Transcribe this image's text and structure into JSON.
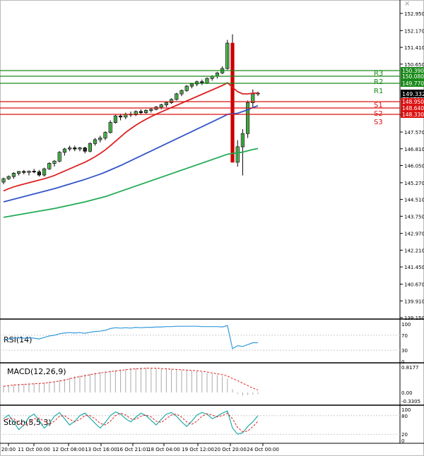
{
  "chart_data": {
    "type": "candlestick",
    "main": {
      "y_ticks": [
        "152.950",
        "152.170",
        "151.410",
        "150.650",
        "149.110",
        "148.350",
        "147.570",
        "146.810",
        "146.050",
        "145.270",
        "144.510",
        "143.750",
        "142.970",
        "142.210",
        "141.450",
        "140.670",
        "139.910",
        "139.150"
      ],
      "current_price": "149.332",
      "levels": [
        {
          "name": "R3",
          "value": "150.390",
          "kind": "resistance"
        },
        {
          "name": "R2",
          "value": "150.080",
          "kind": "resistance"
        },
        {
          "name": "R1",
          "value": "149.770",
          "kind": "resistance"
        },
        {
          "name": "S1",
          "value": "148.950",
          "kind": "support"
        },
        {
          "name": "S2",
          "value": "148.640",
          "kind": "support"
        },
        {
          "name": "S3",
          "value": "148.330",
          "kind": "support"
        }
      ],
      "candles": [
        [
          145.3,
          145.5,
          145.2,
          145.45
        ],
        [
          145.45,
          145.6,
          145.4,
          145.55
        ],
        [
          145.55,
          145.75,
          145.45,
          145.7
        ],
        [
          145.7,
          145.8,
          145.6,
          145.78
        ],
        [
          145.78,
          145.85,
          145.65,
          145.74
        ],
        [
          145.74,
          145.82,
          145.6,
          145.79
        ],
        [
          145.79,
          145.9,
          145.7,
          145.76
        ],
        [
          145.76,
          145.85,
          145.55,
          145.62
        ],
        [
          145.62,
          145.95,
          145.55,
          145.9
        ],
        [
          145.9,
          146.2,
          145.85,
          146.15
        ],
        [
          146.15,
          146.3,
          146.0,
          146.25
        ],
        [
          146.25,
          146.7,
          146.2,
          146.65
        ],
        [
          146.65,
          146.85,
          146.5,
          146.8
        ],
        [
          146.8,
          146.95,
          146.7,
          146.85
        ],
        [
          146.85,
          146.95,
          146.7,
          146.8
        ],
        [
          146.8,
          146.9,
          146.7,
          146.85
        ],
        [
          146.85,
          146.9,
          146.6,
          146.7
        ],
        [
          146.7,
          147.1,
          146.65,
          147.05
        ],
        [
          147.05,
          147.3,
          146.95,
          147.22
        ],
        [
          147.22,
          147.4,
          147.1,
          147.3
        ],
        [
          147.3,
          147.6,
          147.2,
          147.55
        ],
        [
          147.55,
          148.1,
          147.5,
          148.0
        ],
        [
          148.0,
          148.35,
          147.95,
          148.3
        ],
        [
          148.3,
          148.4,
          148.1,
          148.25
        ],
        [
          148.25,
          148.45,
          148.15,
          148.38
        ],
        [
          148.38,
          148.5,
          148.25,
          148.35
        ],
        [
          148.35,
          148.55,
          148.3,
          148.5
        ],
        [
          148.5,
          148.6,
          148.35,
          148.45
        ],
        [
          148.45,
          148.6,
          148.4,
          148.55
        ],
        [
          148.55,
          148.65,
          148.45,
          148.6
        ],
        [
          148.6,
          148.75,
          148.55,
          148.7
        ],
        [
          148.7,
          148.85,
          148.6,
          148.8
        ],
        [
          148.8,
          148.95,
          148.7,
          148.9
        ],
        [
          148.9,
          149.1,
          148.85,
          149.05
        ],
        [
          149.05,
          149.35,
          149.0,
          149.3
        ],
        [
          149.3,
          149.5,
          149.2,
          149.45
        ],
        [
          149.45,
          149.7,
          149.4,
          149.65
        ],
        [
          149.65,
          149.8,
          149.55,
          149.75
        ],
        [
          149.75,
          149.9,
          149.65,
          149.85
        ],
        [
          149.85,
          149.95,
          149.7,
          149.8
        ],
        [
          149.8,
          150.05,
          149.75,
          150.0
        ],
        [
          150.0,
          150.15,
          149.9,
          150.1
        ],
        [
          150.1,
          150.3,
          150.0,
          150.25
        ],
        [
          150.25,
          150.55,
          150.2,
          150.45
        ],
        [
          150.45,
          151.75,
          150.4,
          151.6
        ],
        [
          151.6,
          152.0,
          146.7,
          146.2
        ],
        [
          146.2,
          147.2,
          146.0,
          146.9
        ],
        [
          146.9,
          147.7,
          145.6,
          147.5
        ],
        [
          147.5,
          149.0,
          147.3,
          148.9
        ],
        [
          148.9,
          149.5,
          148.7,
          149.3
        ],
        [
          149.3,
          149.4,
          149.2,
          149.33
        ]
      ],
      "ma_fast": [
        144.9,
        145.0,
        145.08,
        145.15,
        145.21,
        145.27,
        145.33,
        145.39,
        145.45,
        145.52,
        145.6,
        145.7,
        145.8,
        145.9,
        146.0,
        146.1,
        146.2,
        146.32,
        146.45,
        146.6,
        146.76,
        146.95,
        147.15,
        147.35,
        147.55,
        147.72,
        147.88,
        148.02,
        148.15,
        148.27,
        148.38,
        148.48,
        148.58,
        148.68,
        148.78,
        148.88,
        148.98,
        149.08,
        149.18,
        149.28,
        149.38,
        149.48,
        149.58,
        149.68,
        149.8,
        149.6,
        149.4,
        149.3,
        149.3,
        149.33,
        149.34
      ],
      "ma_mid": [
        144.4,
        144.46,
        144.52,
        144.58,
        144.64,
        144.7,
        144.76,
        144.82,
        144.88,
        144.94,
        145.0,
        145.07,
        145.14,
        145.21,
        145.28,
        145.35,
        145.42,
        145.5,
        145.58,
        145.66,
        145.75,
        145.85,
        145.95,
        146.05,
        146.16,
        146.27,
        146.38,
        146.49,
        146.6,
        146.71,
        146.82,
        146.93,
        147.04,
        147.15,
        147.26,
        147.37,
        147.48,
        147.59,
        147.7,
        147.81,
        147.92,
        148.03,
        148.14,
        148.25,
        148.37,
        148.4,
        148.42,
        148.5,
        148.58,
        148.68,
        148.76
      ],
      "ma_slow": [
        143.7,
        143.74,
        143.78,
        143.82,
        143.86,
        143.9,
        143.94,
        143.98,
        144.02,
        144.06,
        144.1,
        144.15,
        144.2,
        144.25,
        144.3,
        144.35,
        144.4,
        144.46,
        144.52,
        144.58,
        144.64,
        144.72,
        144.8,
        144.88,
        144.96,
        145.04,
        145.12,
        145.2,
        145.28,
        145.36,
        145.44,
        145.52,
        145.6,
        145.68,
        145.76,
        145.84,
        145.92,
        146.0,
        146.08,
        146.16,
        146.24,
        146.32,
        146.4,
        146.48,
        146.56,
        146.6,
        146.62,
        146.66,
        146.72,
        146.78,
        146.82
      ]
    },
    "rsi": {
      "label": "RSI(14)",
      "y_ticks": [
        "100",
        "70",
        "30",
        "0"
      ],
      "values": [
        58,
        60,
        62,
        63,
        62,
        63,
        62,
        60,
        64,
        68,
        70,
        74,
        76,
        77,
        76,
        77,
        75,
        78,
        80,
        81,
        83,
        88,
        90,
        89,
        90,
        89,
        91,
        90,
        91,
        91,
        92,
        92,
        93,
        93,
        94,
        94,
        94,
        94,
        94,
        93,
        93,
        93,
        93,
        92,
        96,
        34,
        42,
        40,
        45,
        50,
        50
      ]
    },
    "macd": {
      "label": "MACD(12,26,9)",
      "y_ticks": [
        "0.8177",
        "0.00",
        "-0.3305"
      ],
      "histogram": [
        0.22,
        0.24,
        0.26,
        0.27,
        0.28,
        0.29,
        0.3,
        0.3,
        0.32,
        0.34,
        0.36,
        0.4,
        0.44,
        0.48,
        0.52,
        0.55,
        0.58,
        0.61,
        0.64,
        0.66,
        0.68,
        0.7,
        0.72,
        0.74,
        0.76,
        0.78,
        0.79,
        0.8,
        0.8,
        0.79,
        0.78,
        0.77,
        0.76,
        0.75,
        0.74,
        0.72,
        0.71,
        0.7,
        0.68,
        0.66,
        0.63,
        0.6,
        0.56,
        0.52,
        0.45,
        0.1,
        -0.06,
        -0.12,
        -0.1,
        -0.08,
        -0.06
      ],
      "signal": [
        0.2,
        0.22,
        0.24,
        0.25,
        0.26,
        0.27,
        0.28,
        0.29,
        0.3,
        0.32,
        0.34,
        0.37,
        0.4,
        0.44,
        0.48,
        0.51,
        0.54,
        0.57,
        0.6,
        0.63,
        0.65,
        0.67,
        0.69,
        0.71,
        0.73,
        0.75,
        0.76,
        0.77,
        0.78,
        0.78,
        0.78,
        0.77,
        0.76,
        0.75,
        0.74,
        0.73,
        0.72,
        0.71,
        0.7,
        0.68,
        0.66,
        0.63,
        0.6,
        0.57,
        0.53,
        0.45,
        0.38,
        0.3,
        0.22,
        0.14,
        0.08
      ]
    },
    "stoch": {
      "label": "Stoch(5,5,3)",
      "y_ticks": [
        "100",
        "80",
        "20",
        "0"
      ],
      "k": [
        70,
        82,
        60,
        35,
        50,
        75,
        85,
        65,
        40,
        55,
        78,
        90,
        70,
        50,
        62,
        80,
        88,
        72,
        55,
        40,
        58,
        80,
        92,
        85,
        70,
        60,
        75,
        88,
        80,
        65,
        50,
        68,
        85,
        90,
        78,
        60,
        45,
        62,
        82,
        90,
        85,
        70,
        78,
        88,
        95,
        40,
        20,
        25,
        45,
        60,
        80
      ],
      "d": [
        65,
        72,
        70,
        58,
        48,
        55,
        70,
        72,
        62,
        52,
        62,
        78,
        80,
        68,
        60,
        68,
        80,
        80,
        70,
        55,
        50,
        62,
        80,
        88,
        82,
        70,
        68,
        78,
        82,
        76,
        62,
        58,
        70,
        82,
        85,
        75,
        60,
        52,
        62,
        78,
        86,
        82,
        76,
        80,
        88,
        70,
        42,
        28,
        30,
        45,
        62
      ]
    },
    "x_labels": [
      "20:00",
      "11 Oct 00:00",
      "12 Oct 08:00",
      "13 Oct 16:00",
      "16 Oct 21:01",
      "18 Oct 04:00",
      "19 Oct 12:00",
      "20 Oct 20:00",
      "24 Oct 00:00"
    ]
  }
}
